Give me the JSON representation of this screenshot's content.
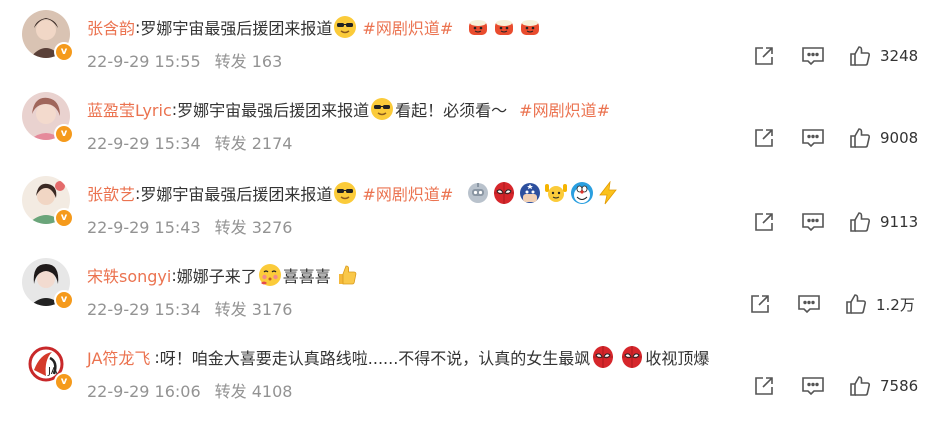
{
  "repost_label": "转发",
  "colors": {
    "accent": "#eb7350",
    "meta": "#939393",
    "badge": "#f59a1c"
  },
  "comments": [
    {
      "author": "张含韵",
      "text": "罗娜宇宙最强后援团来报道",
      "topic": "#网剧炽道#",
      "emojis": [
        "sunglasses-emoji",
        "drum-emoji",
        "drum-emoji",
        "drum-emoji"
      ],
      "time": "22-9-29 15:55",
      "reposts": "163",
      "likes": "3248"
    },
    {
      "author": "蓝盈莹Lyric",
      "text": "罗娜宇宙最强后援团来报道",
      "text_after": "看起！必须看～",
      "topic": "#网剧炽道#",
      "emojis": [
        "sunglasses-emoji"
      ],
      "time": "22-9-29 15:34",
      "reposts": "2174",
      "likes": "9008"
    },
    {
      "author": "张歆艺",
      "text": "罗娜宇宙最强后援团来报道",
      "topic": "#网剧炽道#",
      "emojis": [
        "sunglasses-emoji",
        "robot-emoji",
        "spiderman-emoji",
        "captain-emoji",
        "flex-emoji",
        "doraemon-emoji",
        "lightning-emoji"
      ],
      "time": "22-9-29 15:43",
      "reposts": "3276",
      "likes": "9113"
    },
    {
      "author": "宋轶songyi",
      "text": "娜娜子来了",
      "text_after": "喜喜喜",
      "emojis": [
        "blush-emoji",
        "thumbs-up-emoji"
      ],
      "time": "22-9-29 15:34",
      "reposts": "3176",
      "likes": "1.2万"
    },
    {
      "author": "JA符龙飞",
      "text": "呀！咱金大喜要走认真路线啦......不得不说，认真的女生最飒",
      "text_after": "收视顶爆",
      "emojis": [
        "spiderman-emoji",
        "spiderman-emoji"
      ],
      "time": "22-9-29 16:06",
      "reposts": "4108",
      "likes": "7586"
    }
  ]
}
